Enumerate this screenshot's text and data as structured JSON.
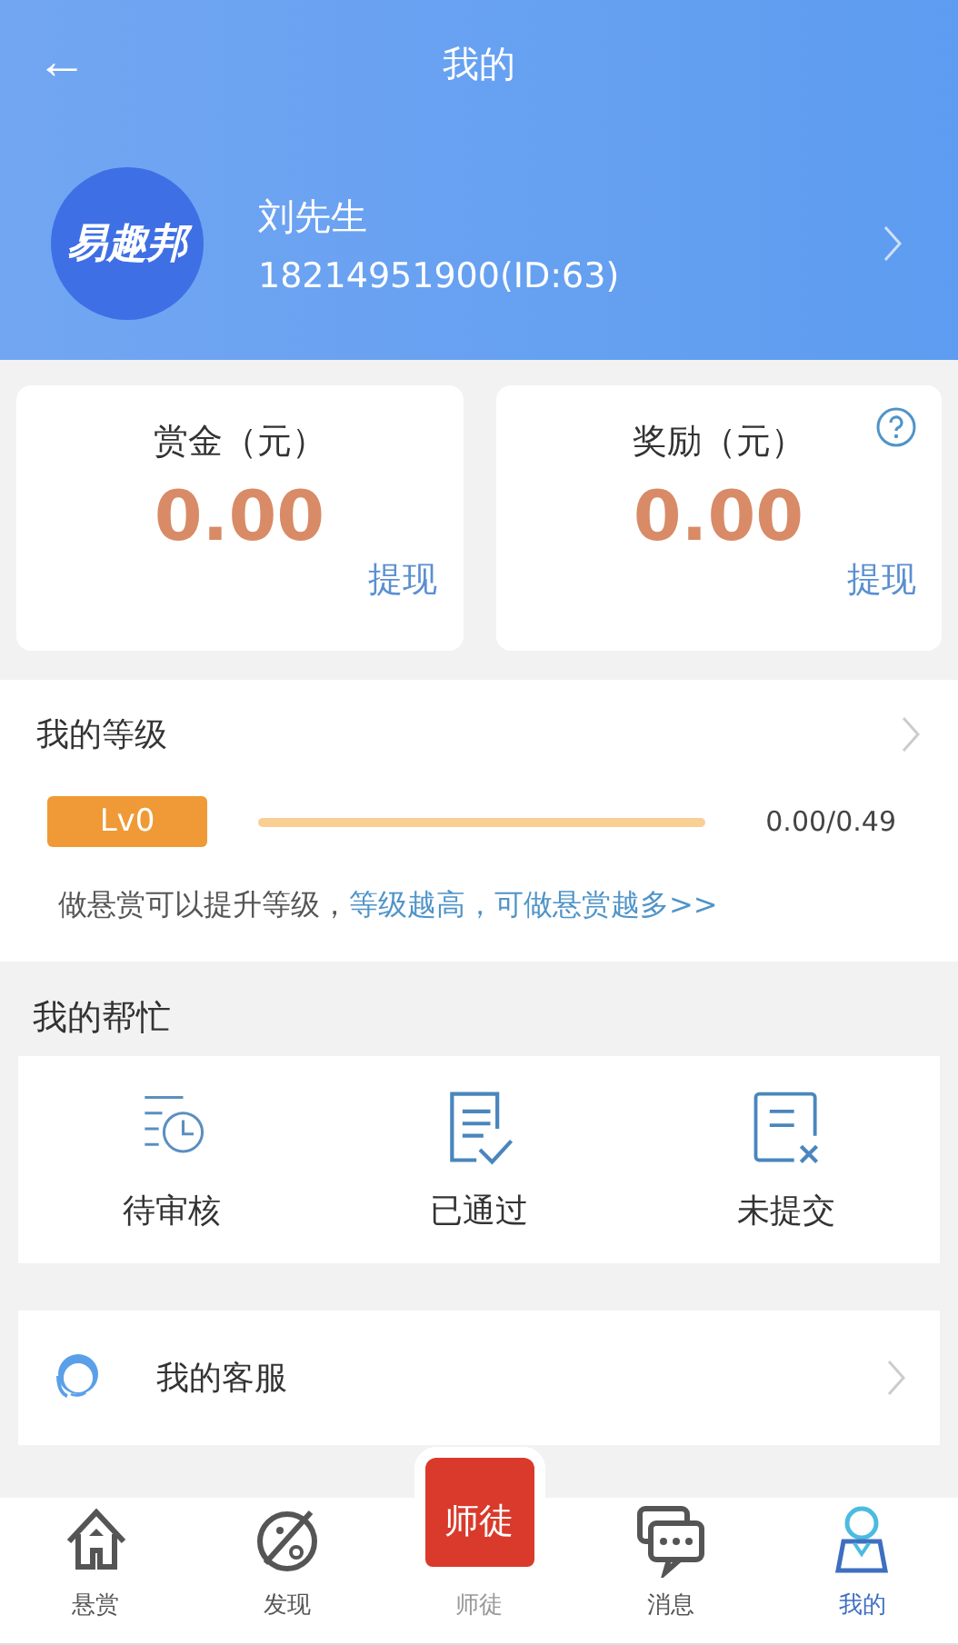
{
  "header": {
    "back": "←",
    "title": "我的"
  },
  "profile": {
    "logo": "易趣邦",
    "name": "刘先生",
    "phone": "18214951900(ID:63)"
  },
  "wallets": [
    {
      "label": "赏金（元）",
      "amount": "0.00",
      "action": "提现",
      "help": false
    },
    {
      "label": "奖励（元）",
      "amount": "0.00",
      "action": "提现",
      "help": true
    }
  ],
  "level": {
    "title": "我的等级",
    "badge": "Lv0",
    "level": 0,
    "reading": "0.00/0.49",
    "note": "做悬赏可以提升等级，",
    "link": "等级越高，可做悬赏越多>>"
  },
  "help": {
    "title": "我的帮忙",
    "items": [
      {
        "kind": "pending",
        "label": "待审核"
      },
      {
        "kind": "passed",
        "label": "已通过"
      },
      {
        "kind": "unsubmitted",
        "label": "未提交"
      }
    ]
  },
  "service": {
    "label": "我的客服"
  },
  "tabs": [
    {
      "kind": "home",
      "label": "悬赏",
      "selected": false
    },
    {
      "kind": "discover",
      "label": "发现",
      "selected": false
    },
    {
      "kind": "center",
      "label": "师徒",
      "badge": "师徒",
      "selected": false
    },
    {
      "kind": "message",
      "label": "消息",
      "selected": false
    },
    {
      "kind": "user",
      "label": "我的",
      "selected": true
    }
  ]
}
